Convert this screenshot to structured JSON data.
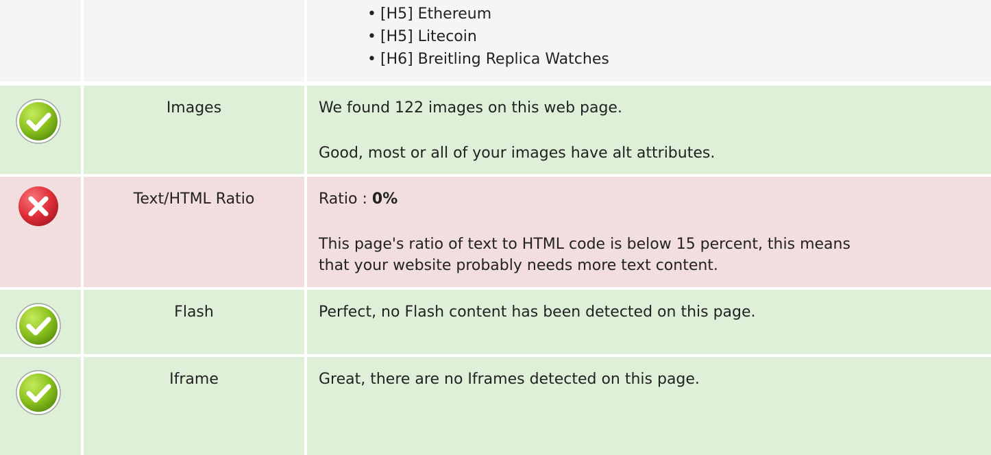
{
  "headings_partial": {
    "items": [
      "[H5] Ethereum",
      "[H5] Litecoin",
      "[H6] Breitling Replica Watches"
    ]
  },
  "rows": [
    {
      "status": "pass",
      "icon": "checkmark-icon",
      "label": "Images",
      "lines": [
        "We found 122 images on this web page.",
        "Good, most or all of your images have alt attributes."
      ]
    },
    {
      "status": "fail",
      "icon": "cross-icon",
      "label": "Text/HTML Ratio",
      "ratio_prefix": "Ratio : ",
      "ratio_value": "0%",
      "lines": [
        "This page's ratio of text to HTML code is below 15 percent, this means",
        "that your website probably needs more text content."
      ]
    },
    {
      "status": "pass",
      "icon": "checkmark-icon",
      "label": "Flash",
      "lines": [
        "Perfect, no Flash content has been detected on this page."
      ]
    },
    {
      "status": "pass",
      "icon": "checkmark-icon",
      "label": "Iframe",
      "lines": [
        "Great, there are no Iframes detected on this page."
      ]
    }
  ],
  "colors": {
    "pass_bg": "#dff0d8",
    "fail_bg": "#f2dede",
    "neutral_bg": "#f5f5f5",
    "pass_icon": "#8bc21d",
    "fail_icon": "#e0303a"
  }
}
